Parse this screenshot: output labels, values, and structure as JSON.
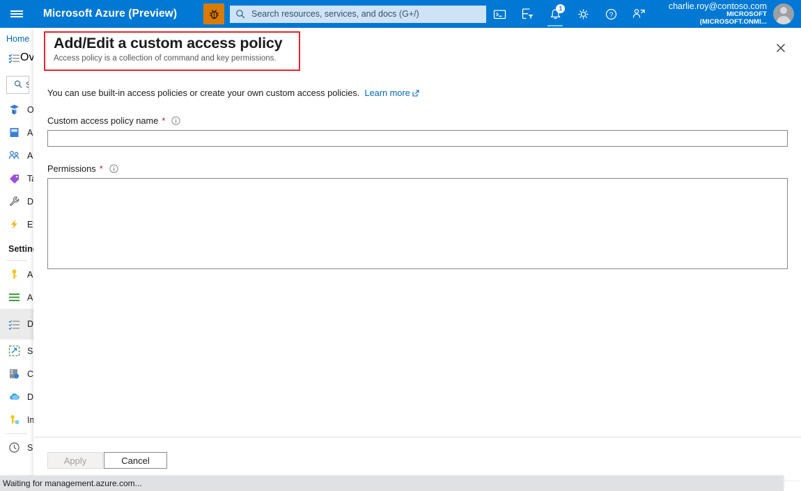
{
  "topbar": {
    "menu_icon": "hamburger-icon",
    "brand": "Microsoft Azure (Preview)",
    "bug_icon": "bug-icon",
    "search": {
      "icon": "search-icon",
      "placeholder": "Search resources, services, and docs (G+/)",
      "value": ""
    },
    "icons": [
      {
        "name": "cloud-shell-icon",
        "glyph": ">_"
      },
      {
        "name": "filter-directory-icon",
        "glyph": "filter"
      },
      {
        "name": "notifications-bell-icon",
        "glyph": "bell",
        "badge": "1"
      },
      {
        "name": "settings-gear-icon",
        "glyph": "gear"
      },
      {
        "name": "help-question-icon",
        "glyph": "?"
      },
      {
        "name": "feedback-person-icon",
        "glyph": "person"
      }
    ],
    "account": {
      "email": "charlie.roy@contoso.com",
      "tenant": "MICROSOFT (MICROSOFT.ONMI..."
    },
    "accent_color": "#0078d4"
  },
  "sidebar": {
    "breadcrumb": "Home",
    "overview_label": "Overview",
    "search_placeholder": "Search",
    "items": [
      {
        "label": "Overview",
        "icon": "checklist-icon"
      },
      {
        "label": "Overview",
        "icon": "cube-icon"
      },
      {
        "label": "Activity log",
        "icon": "book-icon"
      },
      {
        "label": "Access control (IAM)",
        "icon": "people-icon"
      },
      {
        "label": "Tags",
        "icon": "tag-icon"
      },
      {
        "label": "Diagnose and solve problems",
        "icon": "wrench-icon"
      },
      {
        "label": "Events",
        "icon": "lightning-icon"
      }
    ],
    "settings_section": "Settings",
    "settings_items": [
      {
        "label": "Access keys",
        "icon": "key-icon"
      },
      {
        "label": "Advanced settings",
        "icon": "list-lines-icon"
      },
      {
        "label": "Data Access Configuration",
        "icon": "access-policy-icon",
        "selected": true
      },
      {
        "label": "Scale",
        "icon": "scale-icon"
      },
      {
        "label": "Cluster size",
        "icon": "server-icon"
      },
      {
        "label": "Data persistence",
        "icon": "cloud-icon"
      },
      {
        "label": "Import data",
        "icon": "import-key-icon"
      },
      {
        "label": "Schedule updates",
        "icon": "clock-icon"
      }
    ]
  },
  "blade": {
    "title": "Add/Edit a custom access policy",
    "subtitle": "Access policy is a collection of command and key permissions.",
    "close_icon": "close-icon",
    "highlight_color": "#e8222e",
    "intro_text": "You can use built-in access policies or create your own custom access policies.",
    "learn_more": "Learn more",
    "learn_more_icon": "external-link-icon",
    "fields": [
      {
        "label": "Custom access policy name",
        "required": "*",
        "info_icon": "info-icon",
        "value": "",
        "placeholder": ""
      },
      {
        "label": "Permissions",
        "required": "*",
        "info_icon": "info-icon",
        "value": "",
        "placeholder": ""
      }
    ],
    "footer": {
      "apply_label": "Apply",
      "cancel_label": "Cancel"
    }
  },
  "statusbar": {
    "text": "Waiting for management.azure.com..."
  }
}
